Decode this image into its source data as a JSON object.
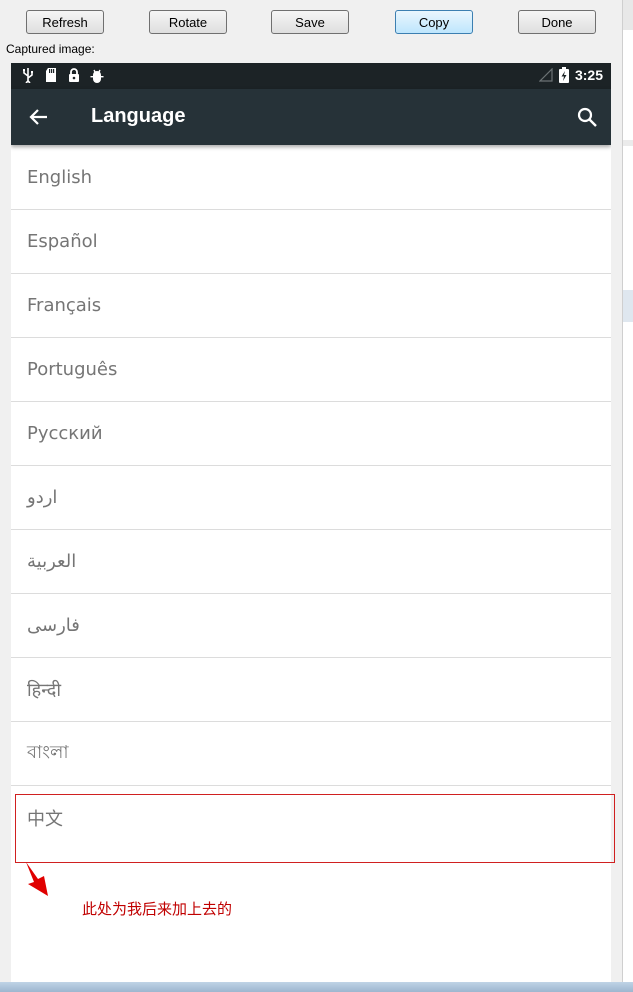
{
  "toolbar": {
    "refresh_label": "Refresh",
    "rotate_label": "Rotate",
    "save_label": "Save",
    "copy_label": "Copy",
    "done_label": "Done"
  },
  "captured_label": "Captured image:",
  "statusbar": {
    "icons": [
      "usb-icon",
      "sd-card-icon",
      "lock-icon",
      "android-debug-icon"
    ],
    "time": "3:25"
  },
  "appbar": {
    "title": "Language"
  },
  "languages": [
    {
      "label": "English"
    },
    {
      "label": "Español"
    },
    {
      "label": "Français"
    },
    {
      "label": "Português"
    },
    {
      "label": "Русский"
    },
    {
      "label": "اردو"
    },
    {
      "label": "العربية"
    },
    {
      "label": "فارسی"
    },
    {
      "label": "हिन्दी"
    },
    {
      "label": "বাংলা"
    },
    {
      "label": "中文"
    }
  ],
  "annotation": "此处为我后来加上去的",
  "colors": {
    "appbar": "#263238",
    "statusbar": "#1c2326",
    "annotation": "#c00000"
  }
}
